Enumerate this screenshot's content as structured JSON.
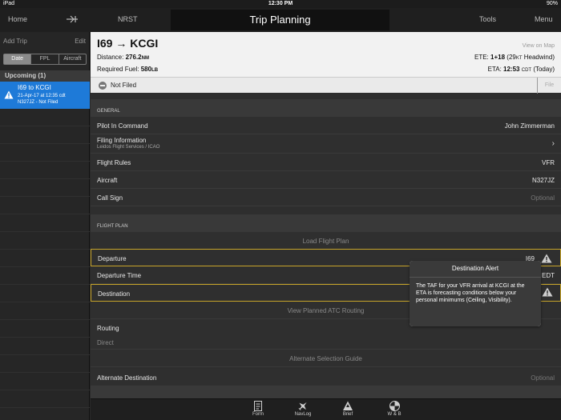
{
  "status": {
    "carrier": "iPad",
    "time": "12:30 PM",
    "battery": "90%"
  },
  "nav": {
    "home": "Home",
    "nrst": "NRST",
    "title": "Trip Planning",
    "tools": "Tools",
    "menu": "Menu"
  },
  "sidebar": {
    "add_trip": "Add Trip",
    "edit": "Edit",
    "segments": [
      "Date",
      "FPL",
      "Aircraft"
    ],
    "section": "Upcoming (1)",
    "trip": {
      "title": "I69 to KCGI",
      "date": "21-Apr-17 at 12:35 cdt",
      "status": "N327JZ - Not Filed"
    }
  },
  "header": {
    "route": "I69 → KCGI",
    "distance_label": "Distance:",
    "distance_value": "276.2",
    "distance_unit": "NM",
    "fuel_label": "Required Fuel:",
    "fuel_value": "580",
    "fuel_unit": "LB",
    "view_map": "View on Map",
    "ete_label": "ETE:",
    "ete_value": "1+18",
    "ete_detail_num": "(29",
    "ete_detail_unit": "KT",
    "ete_detail_rest": "Headwind)",
    "eta_label": "ETA:",
    "eta_value": "12:53",
    "eta_zone": "CDT",
    "eta_day": "(Today)"
  },
  "filing": {
    "status": "Not Filed",
    "file": "File"
  },
  "general": {
    "section": "GENERAL",
    "pic_label": "Pilot In Command",
    "pic_value": "John Zimmerman",
    "filing_label": "Filing Information",
    "filing_sub": "Leidos Flight Services / ICAO",
    "rules_label": "Flight Rules",
    "rules_value": "VFR",
    "aircraft_label": "Aircraft",
    "aircraft_value": "N327JZ",
    "callsign_label": "Call Sign",
    "callsign_value": "Optional"
  },
  "flightplan": {
    "section": "FLIGHT PLAN",
    "load": "Load Flight Plan",
    "departure_label": "Departure",
    "departure_value": "I69",
    "deptime_label": "Departure Time",
    "deptime_value": "5 EDT",
    "destination_label": "Destination",
    "atc_routing": "View Planned ATC Routing",
    "routing_label": "Routing",
    "routing_value": "Direct",
    "alt_guide": "Alternate Selection Guide",
    "alt_dest_label": "Alternate Destination",
    "alt_dest_value": "Optional"
  },
  "alert": {
    "title": "Destination Alert",
    "body": "The TAF for your VFR arrival at KCGI at the ETA is forecasting conditions below your personal minimums (Ceiling, Visibility)."
  },
  "tabs": [
    "Form",
    "NavLog",
    "Brief",
    "W & B"
  ],
  "colors": {
    "accent": "#1e7ad8",
    "warning_outline": "#c8a52a"
  }
}
